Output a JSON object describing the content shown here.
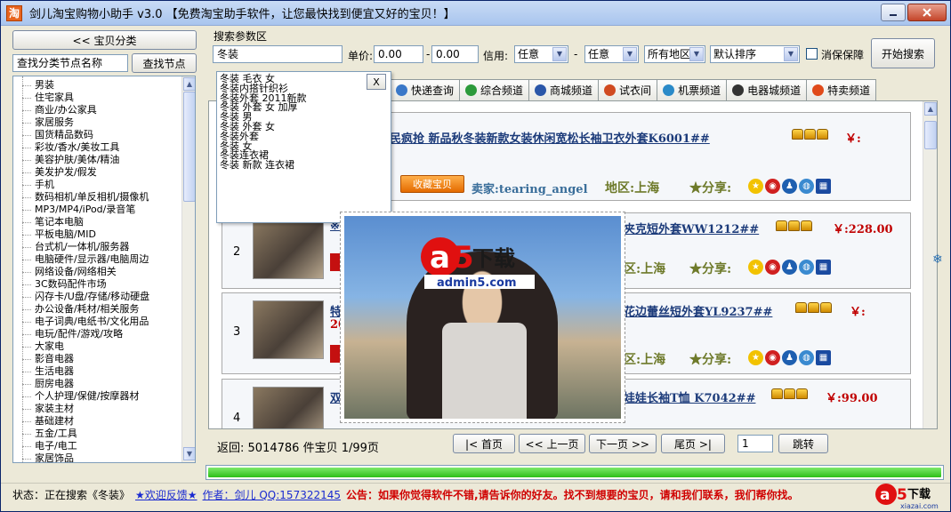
{
  "window": {
    "title": "剑儿淘宝购物小助手 v3.0 【免费淘宝助手软件，让您最快找到便宜又好的宝贝！】",
    "app_icon": "淘"
  },
  "sidebar": {
    "category_button": "<<   宝贝分类",
    "search_label": "查找分类节点名称",
    "search_button": "查找节点",
    "items": [
      "男装",
      "住宅家具",
      "商业/办公家具",
      "家居服务",
      "国货精品数码",
      "彩妆/香水/美妆工具",
      "美容护肤/美体/精油",
      "美发护发/假发",
      "手机",
      "数码相机/单反相机/摄像机",
      "MP3/MP4/iPod/录音笔",
      "笔记本电脑",
      "平板电脑/MID",
      "台式机/一体机/服务器",
      "电脑硬件/显示器/电脑周边",
      "网络设备/网络相关",
      "3C数码配件市场",
      "闪存卡/U盘/存储/移动硬盘",
      "办公设备/耗材/相关服务",
      "电子词典/电纸书/文化用品",
      "电玩/配件/游戏/攻略",
      "大家电",
      "影音电器",
      "生活电器",
      "厨房电器",
      "个人护理/保健/按摩器材",
      "家装主材",
      "基础建材",
      "五金/工具",
      "电子/电工",
      "家居饰品"
    ]
  },
  "search": {
    "section_label": "搜索参数区",
    "keyword": "冬装",
    "price_label": "单价:",
    "price_min": "0.00",
    "price_dash": "-",
    "price_max": "0.00",
    "credit_label": "信用:",
    "credit_min": "任意",
    "credit_dash": "-",
    "credit_max": "任意",
    "region": "所有地区",
    "sort": "默认排序",
    "guarantee_label": "消保保障",
    "start_button": "开始搜索"
  },
  "suggestions": {
    "close": "X",
    "items": [
      "冬装 毛衣 女",
      "冬装内搭针织衫",
      "冬装外套 2011新款",
      "冬装 外套 女 加厚",
      "冬装 男",
      "冬装 外套 女",
      "冬装外套",
      "冬装 女",
      "冬装连衣裙",
      "冬装 新款 连衣裙"
    ]
  },
  "tabs": [
    {
      "label": "快递查询",
      "icon": "express-icon",
      "color": "#3a78c8"
    },
    {
      "label": "综合频道",
      "icon": "channel-icon",
      "color": "#2c9a3a"
    },
    {
      "label": "商城频道",
      "icon": "mall-icon",
      "color": "#2a56a8"
    },
    {
      "label": "试衣间",
      "icon": "fitting-icon",
      "color": "#d04a20"
    },
    {
      "label": "机票频道",
      "icon": "plane-icon",
      "color": "#2a8ac8"
    },
    {
      "label": "电器城频道",
      "icon": "appliance-icon",
      "color": "#333333"
    },
    {
      "label": "特卖频道",
      "icon": "sale-icon",
      "color": "#e04a1a"
    }
  ],
  "results": [
    {
      "num": "1",
      "title": "民疯抢  新品秋冬装新款女装休闲宽松长袖卫衣外套K6001##",
      "price": "￥:",
      "collect": "收藏宝贝",
      "seller_label": "卖家:",
      "seller": "tearing_angel",
      "region_label": "地区:",
      "region": "上海",
      "share": "★分享:"
    },
    {
      "num": "2",
      "title": "夹克短外套WW1212##",
      "price": "￥:228.00",
      "region_label": "区:",
      "region": "上海",
      "share": "★分享:"
    },
    {
      "num": "3",
      "title": "花边蕾丝短外套YL9237##",
      "price": "￥:",
      "region_label": "区:",
      "region": "上海",
      "share": "★分享:"
    },
    {
      "num": "4",
      "title": "娃娃长袖T恤  K7042##",
      "price": "￥:99.00"
    }
  ],
  "fragments": {
    "row2_link": "※",
    "row3_title": "特",
    "row3_price": "20",
    "row4_title": "双"
  },
  "preview": {
    "logo_text": "下载",
    "logo_url": "admin5.com"
  },
  "pager": {
    "total_label": "返回:",
    "total": "5014786",
    "unit": "件宝贝",
    "pages": "1/99页",
    "first": "|< 首页",
    "prev": "<< 上一页",
    "next": "下一页 >>",
    "last": "尾页 >|",
    "page_input": "1",
    "jump": "跳转",
    "progress_fraction": 1.0
  },
  "status": {
    "state": "状态：正在搜索《冬装》",
    "welcome": "★欢迎反馈★",
    "author": "作者：剑儿  QQ:157322145",
    "notice": "公告：如果你觉得软件不错,请告诉你的好友。找不到想要的宝贝，请和我们联系，我们帮你找。"
  },
  "watermark": {
    "text": "下载",
    "url": "xiazai.com"
  }
}
